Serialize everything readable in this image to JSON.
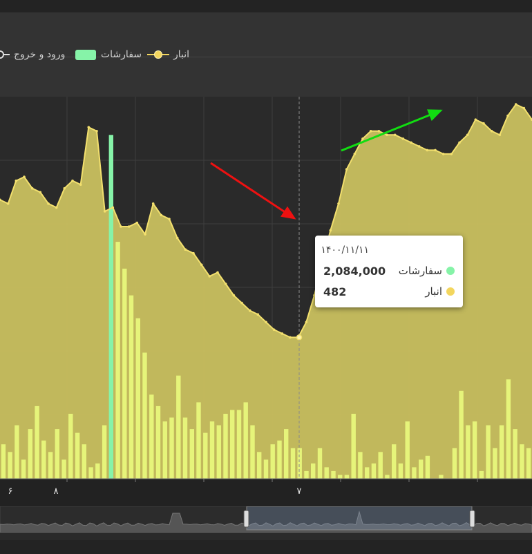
{
  "legend": [
    {
      "label": "انبار",
      "color": "#f3d65e",
      "symbol": "line-dot"
    },
    {
      "label": "سفارشات",
      "color": "#86f3a8",
      "symbol": "rect"
    },
    {
      "label": "ورود و خروج",
      "color": "#e0e0e0",
      "symbol": "line-dot"
    }
  ],
  "tooltip": {
    "date": "۱۴۰۰/۱۱/۱۱",
    "rows": [
      {
        "name": "سفارشات",
        "value": "2,084,000",
        "color": "#86f3a8"
      },
      {
        "name": "انبار",
        "value": "482",
        "color": "#f3d65e"
      }
    ]
  },
  "x_axis_labels": [
    "۶",
    "۸",
    "۷"
  ],
  "colors": {
    "area_fill": "#c9c05f",
    "area_line": "#f3e06e",
    "bars": "#e6f47a",
    "highlight_bar": "#86f3a8",
    "background": "#2a2a2a",
    "arrow_down": "#ee1111",
    "arrow_up": "#11dd11"
  },
  "chart_data": {
    "type": "area",
    "series": [
      {
        "name": "انبار",
        "type": "area",
        "values": [
          73,
          72,
          78,
          79,
          76,
          75,
          72,
          71,
          76,
          78,
          77,
          92,
          91,
          70,
          71,
          66,
          66,
          67,
          64,
          72,
          69,
          68,
          63,
          60,
          59,
          56,
          53,
          54,
          51,
          48,
          46,
          44,
          43,
          41,
          39,
          38,
          37,
          37,
          41,
          48,
          57,
          65,
          72,
          81,
          85,
          89,
          91,
          91,
          90,
          90,
          89,
          88,
          87,
          86,
          86,
          85,
          85,
          88,
          90,
          94,
          93,
          91,
          90,
          95,
          98,
          97,
          94
        ]
      },
      {
        "name": "سفارشات",
        "type": "bar",
        "values": [
          9,
          7,
          14,
          5,
          13,
          19,
          10,
          7,
          13,
          5,
          17,
          12,
          9,
          3,
          4,
          14,
          90,
          62,
          55,
          48,
          42,
          33,
          22,
          19,
          15,
          16,
          27,
          16,
          13,
          20,
          12,
          15,
          14,
          17,
          18,
          18,
          20,
          14,
          7,
          5,
          9,
          10,
          13,
          8,
          8,
          2,
          4,
          8,
          3,
          2,
          1,
          1,
          17,
          7,
          3,
          4,
          7,
          1,
          9,
          4,
          15,
          3,
          5,
          6,
          0,
          1,
          0,
          8,
          23,
          14,
          15,
          2,
          14,
          8,
          14,
          26,
          13,
          9,
          8
        ]
      }
    ],
    "highlight": {
      "series": "سفارشات",
      "index": 16
    }
  }
}
